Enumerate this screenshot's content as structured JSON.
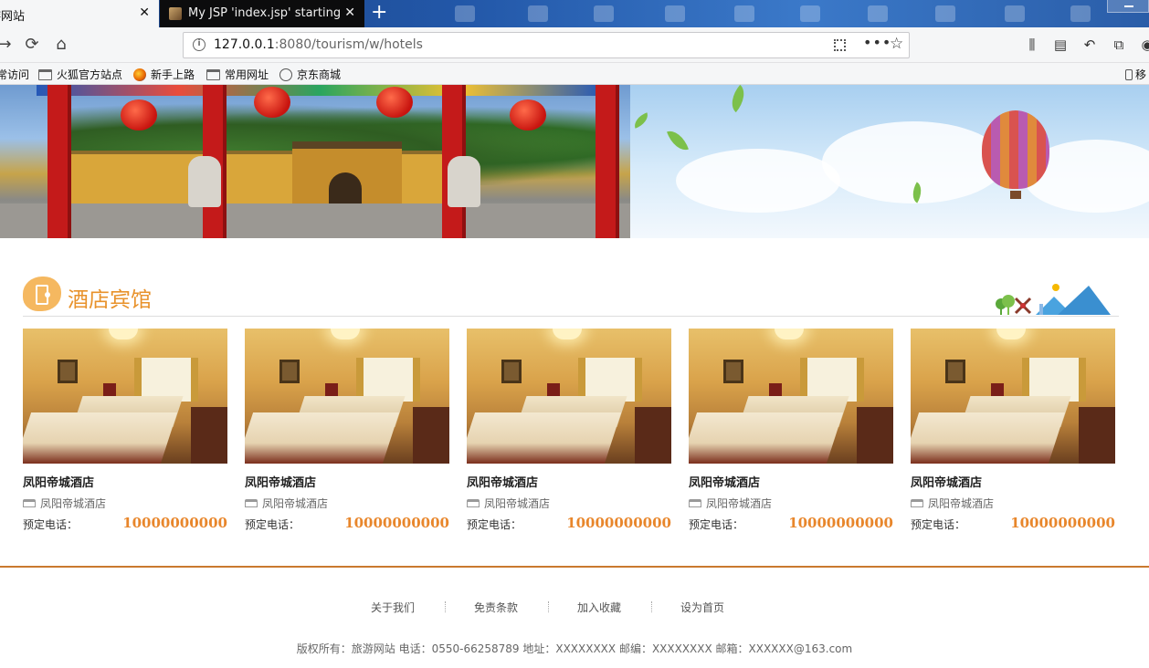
{
  "browser": {
    "tabs": [
      {
        "label": "游网站",
        "close": "✕"
      },
      {
        "label": "My JSP 'index.jsp' starting pa",
        "close": "✕"
      }
    ],
    "new_tab": "+",
    "url_host": "127.0.0.1",
    "url_rest": ":8080/tourism/w/hotels",
    "bookmarks": [
      "常访问",
      "火狐官方站点",
      "新手上路",
      "常用网址",
      "京东商城"
    ],
    "mobile_bookmarks": "移"
  },
  "section": {
    "title": "酒店宾馆"
  },
  "hotels": [
    {
      "name": "凤阳帝城酒店",
      "address": "凤阳帝城酒店",
      "tel_label": "预定电话：",
      "tel": "10000000000"
    },
    {
      "name": "凤阳帝城酒店",
      "address": "凤阳帝城酒店",
      "tel_label": "预定电话：",
      "tel": "10000000000"
    },
    {
      "name": "凤阳帝城酒店",
      "address": "凤阳帝城酒店",
      "tel_label": "预定电话：",
      "tel": "10000000000"
    },
    {
      "name": "凤阳帝城酒店",
      "address": "凤阳帝城酒店",
      "tel_label": "预定电话：",
      "tel": "10000000000"
    },
    {
      "name": "凤阳帝城酒店",
      "address": "凤阳帝城酒店",
      "tel_label": "预定电话：",
      "tel": "10000000000"
    }
  ],
  "footer": {
    "links": [
      "关于我们",
      "免责条款",
      "加入收藏",
      "设为首页"
    ],
    "copyright": "版权所有：旅游网站 电话：0550-66258789 地址：XXXXXXXX 邮编：XXXXXXXX 邮箱：XXXXXX@163.com"
  },
  "colors": {
    "accent": "#e8922b",
    "price": "#e8862b",
    "footer_line": "#c9792f"
  }
}
